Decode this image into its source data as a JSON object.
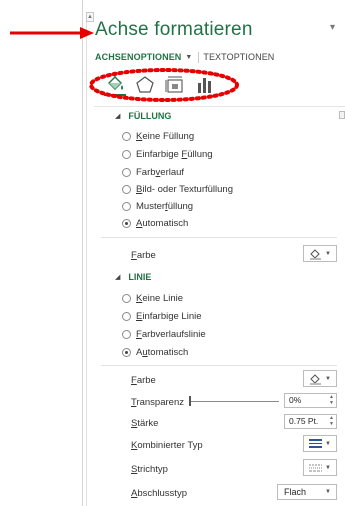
{
  "pane": {
    "title": "Achse formatieren",
    "close_glyph": "▾",
    "tabs": [
      {
        "label": "ACHSENOPTIONEN",
        "caret": "▼"
      },
      {
        "label": "TEXTOPTIONEN"
      }
    ],
    "option_icons": [
      "fill-line-icon",
      "effects-pentagon-icon",
      "size-properties-icon",
      "axis-options-icon"
    ]
  },
  "annotations": {
    "arrow_color": "#e60000",
    "ellipse_color": "#e60000"
  },
  "colors": {
    "accent": "#217346"
  },
  "fill_section": {
    "title": "FÜLLUNG",
    "options": [
      {
        "pre": "",
        "u": "K",
        "post": "eine Füllung",
        "checked": false
      },
      {
        "pre": "Einfarbige ",
        "u": "F",
        "post": "üllung",
        "checked": false
      },
      {
        "pre": "Farb",
        "u": "v",
        "post": "erlauf",
        "checked": false
      },
      {
        "pre": "",
        "u": "B",
        "post": "ild- oder Texturfüllung",
        "checked": false
      },
      {
        "pre": "Muster",
        "u": "f",
        "post": "üllung",
        "checked": false
      },
      {
        "pre": "",
        "u": "A",
        "post": "utomatisch",
        "checked": true
      }
    ],
    "color_label": {
      "u": "F",
      "post": "arbe"
    }
  },
  "line_section": {
    "title": "LINIE",
    "options": [
      {
        "pre": "",
        "u": "K",
        "post": "eine Linie",
        "checked": false
      },
      {
        "pre": "",
        "u": "E",
        "post": "infarbige Linie",
        "checked": false
      },
      {
        "pre": "",
        "u": "F",
        "post": "arbverlaufslinie",
        "checked": false
      },
      {
        "pre": "A",
        "u": "u",
        "post": "tomatisch",
        "checked": true
      }
    ],
    "color_label": {
      "u": "F",
      "post": "arbe"
    },
    "transparency_label": {
      "u": "T",
      "post": "ransparenz"
    },
    "transparency_value": "0%",
    "transparency_level": 0,
    "width_label": {
      "u": "S",
      "post": "tärke"
    },
    "width_value": "0.75 Pt.",
    "compound_label": {
      "u": "K",
      "post": "ombinierter Typ"
    },
    "dash_label": {
      "u": "S",
      "post": "trichtyp"
    },
    "cap_label": {
      "u": "A",
      "post": "bschlusstyp"
    },
    "cap_value": "Flach"
  }
}
